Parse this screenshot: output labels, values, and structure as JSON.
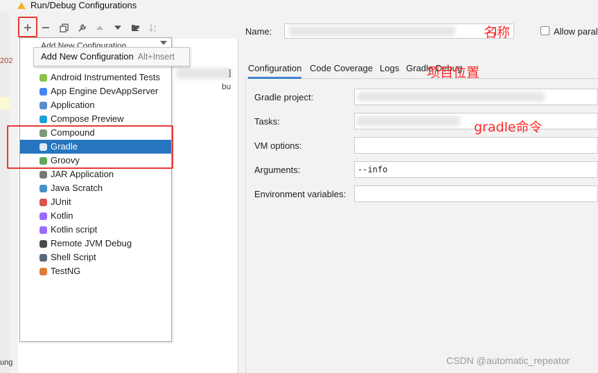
{
  "window": {
    "title": "Run/Debug Configurations"
  },
  "toolbar": {
    "buttons": [
      "add-icon",
      "remove-icon",
      "copy-icon",
      "wrench-icon",
      "move-up-icon",
      "move-down-icon",
      "new-folder-icon",
      "sort-icon"
    ]
  },
  "popup": {
    "header": "Add New Configuration",
    "items": [
      {
        "label": "Android Instrumented Tests",
        "icon": "android-icon",
        "color": "#8bc34a"
      },
      {
        "label": "App Engine DevAppServer",
        "icon": "app-engine-icon",
        "color": "#4285f4"
      },
      {
        "label": "Application",
        "icon": "application-icon",
        "color": "#5b8cc9"
      },
      {
        "label": "Compose Preview",
        "icon": "compose-icon",
        "color": "#1ea0d6"
      },
      {
        "label": "Compound",
        "icon": "compound-icon",
        "color": "#7a9a7a"
      },
      {
        "label": "Gradle",
        "icon": "gradle-icon",
        "color": "#2b5f5a"
      },
      {
        "label": "Groovy",
        "icon": "groovy-icon",
        "color": "#5ca85c"
      },
      {
        "label": "JAR Application",
        "icon": "jar-icon",
        "color": "#777777"
      },
      {
        "label": "Java Scratch",
        "icon": "java-scratch-icon",
        "color": "#4a90c8"
      },
      {
        "label": "JUnit",
        "icon": "junit-icon",
        "color": "#d9534f"
      },
      {
        "label": "Kotlin",
        "icon": "kotlin-icon",
        "color": "#9a6bff"
      },
      {
        "label": "Kotlin script",
        "icon": "kotlin-script-icon",
        "color": "#9a6bff"
      },
      {
        "label": "Remote JVM Debug",
        "icon": "remote-debug-icon",
        "color": "#4a4a4a"
      },
      {
        "label": "Shell Script",
        "icon": "shell-icon",
        "color": "#5a6a7a"
      },
      {
        "label": "TestNG",
        "icon": "testng-icon",
        "color": "#e07b39"
      }
    ],
    "selected_index": 5
  },
  "tooltip": {
    "label": "Add New Configuration",
    "shortcut": "Alt+Insert"
  },
  "name_field": {
    "label": "Name:",
    "value_suffix": "]"
  },
  "allow_parallel": {
    "label": "Allow paral"
  },
  "tabs": [
    "Configuration",
    "Code Coverage",
    "Logs",
    "Gradle Debug"
  ],
  "form": {
    "gradle_project": {
      "label": "Gradle project:",
      "value": ""
    },
    "tasks": {
      "label": "Tasks:",
      "value": ""
    },
    "vm_options": {
      "label": "VM options:",
      "value": ""
    },
    "arguments": {
      "label": "Arguments:",
      "value": "--info"
    },
    "env_vars": {
      "label": "Environment variables:",
      "value": ""
    }
  },
  "annotations": {
    "name": "名称",
    "project_location": "项目位置",
    "gradle_command": "gradle命令",
    "color": "#ff2a2a"
  },
  "background_fragments": {
    "a": "202",
    "b": "ung",
    "c": "]",
    "d": "bu"
  },
  "watermark": "CSDN @automatic_repeator",
  "colors": {
    "selection": "#2675bf",
    "annotation_box": "#e53935",
    "tab_underline": "#4083c9"
  }
}
